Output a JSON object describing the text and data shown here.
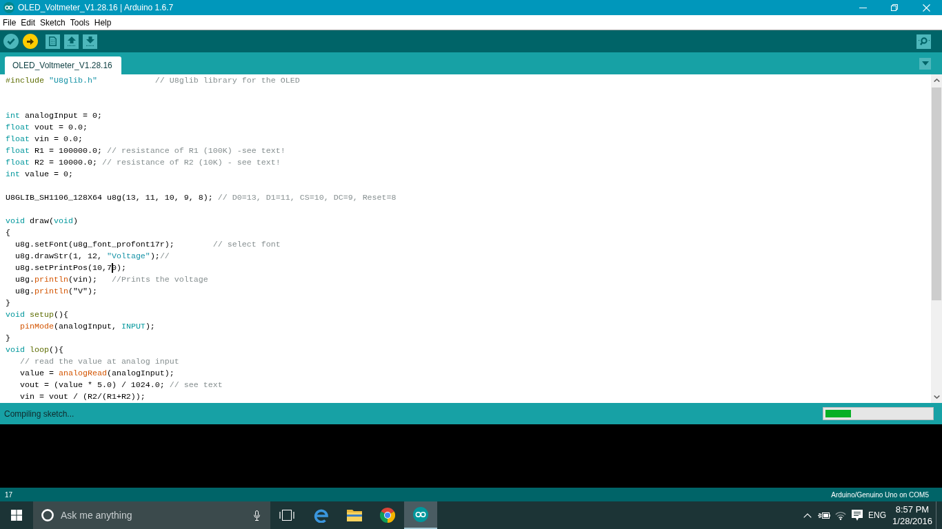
{
  "window": {
    "title": "OLED_Voltmeter_V1.28.16 | Arduino 1.6.7"
  },
  "menu": [
    "File",
    "Edit",
    "Sketch",
    "Tools",
    "Help"
  ],
  "tabs": [
    {
      "label": "OLED_Voltmeter_V1.28.16",
      "selected": true
    }
  ],
  "editor": {
    "lines": [
      {
        "kind": "code",
        "tokens": [
          {
            "kind": "preprocessor",
            "text": "#include"
          },
          {
            "kind": "string",
            "text": " \"U8glib.h\""
          },
          {
            "kind": "comment",
            "text": "            // U8glib library for the OLED"
          }
        ]
      },
      {
        "kind": "blank"
      },
      {
        "kind": "blank"
      },
      {
        "kind": "code",
        "tokens": [
          {
            "kind": "keyword",
            "text": "int"
          },
          {
            "kind": "plain",
            "text": " analogInput = 0;"
          }
        ]
      },
      {
        "kind": "code",
        "tokens": [
          {
            "kind": "keyword",
            "text": "float"
          },
          {
            "kind": "plain",
            "text": " vout = 0.0;"
          }
        ]
      },
      {
        "kind": "code",
        "tokens": [
          {
            "kind": "keyword",
            "text": "float"
          },
          {
            "kind": "plain",
            "text": " vin = 0.0;"
          }
        ]
      },
      {
        "kind": "code",
        "tokens": [
          {
            "kind": "keyword",
            "text": "float"
          },
          {
            "kind": "plain",
            "text": " R1 = 100000.0; "
          },
          {
            "kind": "comment",
            "text": "// resistance of R1 (100K) -see text!"
          }
        ]
      },
      {
        "kind": "code",
        "tokens": [
          {
            "kind": "keyword",
            "text": "float"
          },
          {
            "kind": "plain",
            "text": " R2 = 10000.0; "
          },
          {
            "kind": "comment",
            "text": "// resistance of R2 (10K) - see text!"
          }
        ]
      },
      {
        "kind": "code",
        "tokens": [
          {
            "kind": "keyword",
            "text": "int"
          },
          {
            "kind": "plain",
            "text": " value = 0;"
          }
        ]
      },
      {
        "kind": "blank"
      },
      {
        "kind": "code",
        "tokens": [
          {
            "kind": "plain",
            "text": "U8GLIB_SH1106_128X64 u8g(13, 11, 10, 9, 8); "
          },
          {
            "kind": "comment",
            "text": "// D0=13, D1=11, CS=10, DC=9, Reset=8"
          }
        ]
      },
      {
        "kind": "blank"
      },
      {
        "kind": "code",
        "tokens": [
          {
            "kind": "keyword",
            "text": "void"
          },
          {
            "kind": "plain",
            "text": " draw("
          },
          {
            "kind": "keyword",
            "text": "void"
          },
          {
            "kind": "plain",
            "text": ")"
          }
        ]
      },
      {
        "kind": "code",
        "tokens": [
          {
            "kind": "plain",
            "text": "{"
          }
        ]
      },
      {
        "kind": "code",
        "tokens": [
          {
            "kind": "plain",
            "text": "  u8g.setFont(u8g_font_profont17r);        "
          },
          {
            "kind": "comment",
            "text": "// select font"
          }
        ]
      },
      {
        "kind": "code",
        "tokens": [
          {
            "kind": "plain",
            "text": "  u8g.drawStr(1, 12, "
          },
          {
            "kind": "string",
            "text": "\"Voltage\""
          },
          {
            "kind": "plain",
            "text": ");"
          },
          {
            "kind": "comment",
            "text": "//"
          }
        ]
      },
      {
        "kind": "code",
        "tokens": [
          {
            "kind": "plain",
            "text": "  u8g.setPrintPos(10,7"
          },
          {
            "kind": "caret"
          },
          {
            "kind": "plain",
            "text": "0);"
          }
        ]
      },
      {
        "kind": "code",
        "tokens": [
          {
            "kind": "plain",
            "text": "  u8g."
          },
          {
            "kind": "function",
            "text": "println"
          },
          {
            "kind": "plain",
            "text": "(vin);   "
          },
          {
            "kind": "comment",
            "text": "//Prints the voltage"
          }
        ]
      },
      {
        "kind": "code",
        "tokens": [
          {
            "kind": "plain",
            "text": "  u8g."
          },
          {
            "kind": "function",
            "text": "println"
          },
          {
            "kind": "plain",
            "text": "(\"V\");"
          }
        ]
      },
      {
        "kind": "code",
        "tokens": [
          {
            "kind": "plain",
            "text": "}"
          }
        ]
      },
      {
        "kind": "code",
        "tokens": [
          {
            "kind": "keyword",
            "text": "void"
          },
          {
            "kind": "structure",
            "text": " setup"
          },
          {
            "kind": "plain",
            "text": "(){"
          }
        ]
      },
      {
        "kind": "code",
        "tokens": [
          {
            "kind": "function",
            "text": "   pinMode"
          },
          {
            "kind": "plain",
            "text": "(analogInput, "
          },
          {
            "kind": "keyword",
            "text": "INPUT"
          },
          {
            "kind": "plain",
            "text": ");"
          }
        ]
      },
      {
        "kind": "code",
        "tokens": [
          {
            "kind": "plain",
            "text": "}"
          }
        ]
      },
      {
        "kind": "code",
        "tokens": [
          {
            "kind": "keyword",
            "text": "void"
          },
          {
            "kind": "structure",
            "text": " loop"
          },
          {
            "kind": "plain",
            "text": "(){"
          }
        ]
      },
      {
        "kind": "code",
        "tokens": [
          {
            "kind": "comment",
            "text": "   // read the value at analog input"
          }
        ]
      },
      {
        "kind": "code",
        "tokens": [
          {
            "kind": "plain",
            "text": "   value = "
          },
          {
            "kind": "function",
            "text": "analogRead"
          },
          {
            "kind": "plain",
            "text": "(analogInput);"
          }
        ]
      },
      {
        "kind": "code",
        "tokens": [
          {
            "kind": "plain",
            "text": "   vout = (value * 5.0) / 1024.0; "
          },
          {
            "kind": "comment",
            "text": "// see text"
          }
        ]
      },
      {
        "kind": "code",
        "tokens": [
          {
            "kind": "plain",
            "text": "   vin = vout / (R2/(R1+R2));"
          }
        ]
      }
    ]
  },
  "status": {
    "message": "Compiling sketch...",
    "progress": {
      "level": 0.24
    }
  },
  "footer": {
    "line": "17",
    "board": "Arduino/Genuino Uno on COM5"
  },
  "taskbar": {
    "search": {
      "placeholder": "Ask me anything"
    },
    "apps": [
      {
        "kind": "letter-e",
        "active": false
      },
      {
        "kind": "folder",
        "active": false
      },
      {
        "kind": "ring",
        "active": false
      },
      {
        "kind": "infinity",
        "active": true
      }
    ],
    "language": "ENG",
    "time": "8:57 PM",
    "date": "1/28/2016"
  }
}
